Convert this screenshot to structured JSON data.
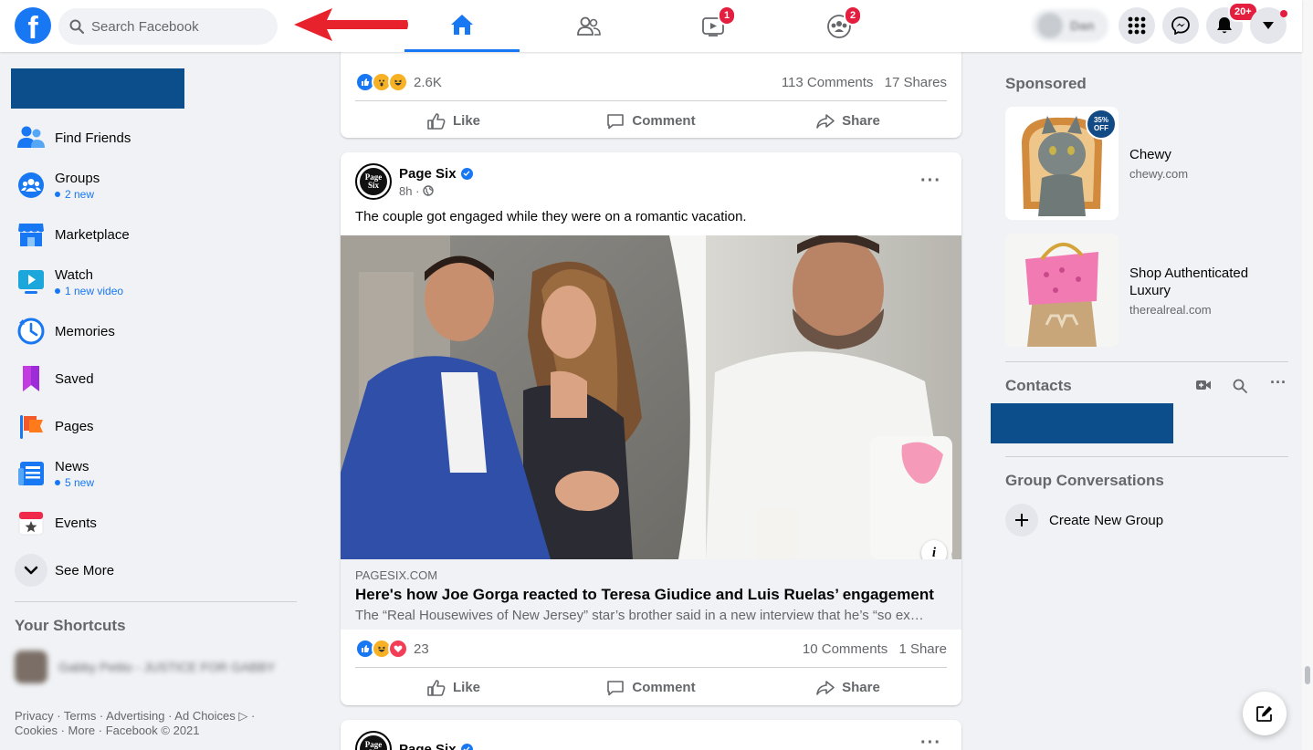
{
  "header": {
    "search_placeholder": "Search Facebook",
    "watch_badge": "1",
    "groups_badge": "2",
    "notifications_badge": "20+",
    "profile_name": "Dan"
  },
  "colors": {
    "brand": "#1877f2",
    "badge_red": "#e41e3f",
    "arrow_red": "#e8222d",
    "blocked_blue": "#0c4d8c"
  },
  "sidebar": {
    "items": [
      {
        "label": "Find Friends",
        "sub": "",
        "icon": "friends-icon"
      },
      {
        "label": "Groups",
        "sub": "2 new",
        "icon": "groups-icon"
      },
      {
        "label": "Marketplace",
        "sub": "",
        "icon": "marketplace-icon"
      },
      {
        "label": "Watch",
        "sub": "1 new video",
        "icon": "watch-icon"
      },
      {
        "label": "Memories",
        "sub": "",
        "icon": "memories-icon"
      },
      {
        "label": "Saved",
        "sub": "",
        "icon": "saved-icon"
      },
      {
        "label": "Pages",
        "sub": "",
        "icon": "pages-icon"
      },
      {
        "label": "News",
        "sub": "5 new",
        "icon": "news-icon"
      },
      {
        "label": "Events",
        "sub": "",
        "icon": "events-icon"
      },
      {
        "label": "See More",
        "sub": "",
        "icon": "chevron-down-icon"
      }
    ],
    "shortcuts_title": "Your Shortcuts",
    "shortcut_label": "Gabby Petito - JUSTICE FOR GABBY",
    "footer_line1": "Privacy · Terms · Advertising · Ad Choices ▷ ·",
    "footer_line2": "Cookies · More · Facebook © 2021"
  },
  "feed": {
    "prev_post": {
      "reaction_count": "2.6K",
      "comments": "113 Comments",
      "shares": "17 Shares"
    },
    "post": {
      "author": "Page Six",
      "avatar_text": "Page Six",
      "time": "8h ·",
      "text": "The couple got engaged while they were on a romantic vacation.",
      "link_domain": "PAGESIX.COM",
      "link_title": "Here's how Joe Gorga reacted to Teresa Giudice and Luis Ruelas’ engagement",
      "link_desc": "The “Real Housewives of New Jersey” star’s brother said in a new interview that he’s “so ex…",
      "reaction_count": "23",
      "comments": "10 Comments",
      "shares": "1 Share"
    },
    "next_post": {
      "author": "Page Six"
    },
    "actions": {
      "like": "Like",
      "comment": "Comment",
      "share": "Share"
    }
  },
  "right": {
    "sponsored_title": "Sponsored",
    "ads": [
      {
        "title": "Chewy",
        "url": "chewy.com",
        "badge": "35% OFF"
      },
      {
        "title": "Shop Authenticated Luxury",
        "url": "therealreal.com"
      }
    ],
    "contacts_title": "Contacts",
    "group_conv_title": "Group Conversations",
    "create_group": "Create New Group"
  }
}
